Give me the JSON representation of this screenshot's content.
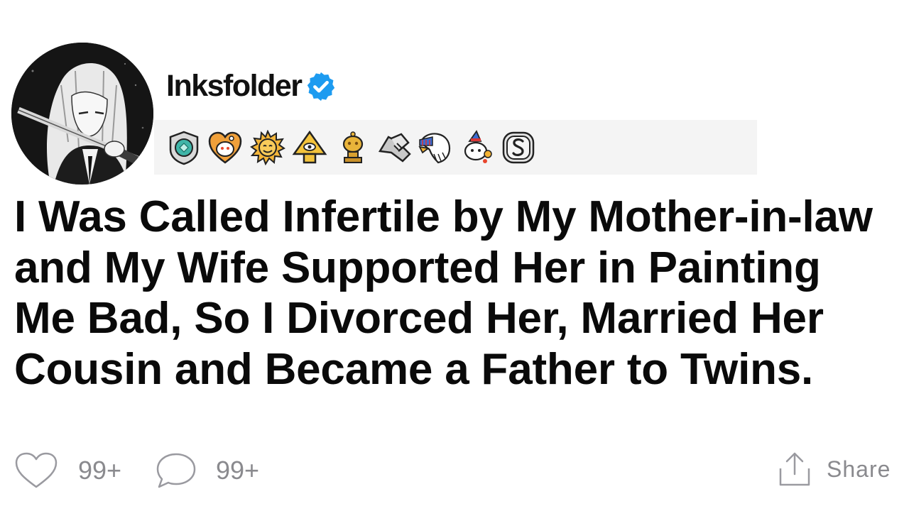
{
  "post": {
    "author": {
      "username": "Inksfolder",
      "verified": true,
      "avatar_icon": "anime-avatar-icon"
    },
    "awards": [
      {
        "icon": "gem-shield-award-icon"
      },
      {
        "icon": "heart-snoo-award-icon"
      },
      {
        "icon": "sun-face-award-icon"
      },
      {
        "icon": "eye-pyramid-award-icon"
      },
      {
        "icon": "gold-snoo-trophy-award-icon"
      },
      {
        "icon": "handshake-award-icon"
      },
      {
        "icon": "eagle-award-icon"
      },
      {
        "icon": "party-snoo-award-icon"
      },
      {
        "icon": "silver-s-award-icon"
      }
    ],
    "title": "I Was Called Infertile by My Mother-in-law and My Wife Supported Her in Painting Me Bad, So I Divorced Her, Married Her Cousin and Became a Father to Twins.",
    "stats": {
      "likes": "99+",
      "comments": "99+",
      "share_label": "Share"
    }
  },
  "colors": {
    "verified": "#1d9bf0",
    "text": "#0a0a0a",
    "muted": "#8a8a8e",
    "award_bar": "#f4f4f4"
  }
}
